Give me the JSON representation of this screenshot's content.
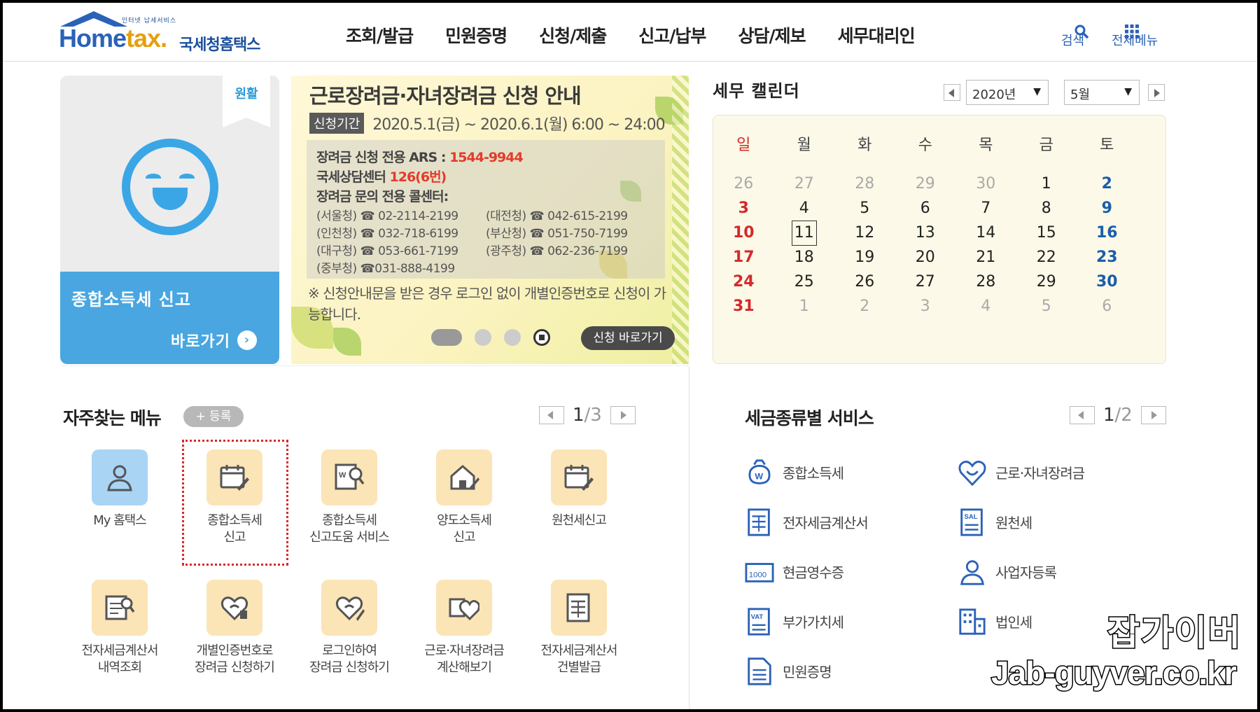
{
  "header": {
    "logo_small": "인터넷 납세서비스",
    "logo_home": "Home",
    "logo_tax": "tax.",
    "logo_name": "국세청홈택스",
    "nav": [
      "조회/발급",
      "민원증명",
      "신청/제출",
      "신고/납부",
      "상담/제보",
      "세무대리인"
    ],
    "search_label": "검색",
    "allmenu_label": "전체메뉴"
  },
  "promo": {
    "ribbon": "원활",
    "title": "종합소득세 신고",
    "go_label": "바로가기"
  },
  "banner": {
    "title": "근로장려금·자녀장려금 신청 안내",
    "period_tag": "신청기간",
    "period_dates": "2020.5.1(금) ~ 2020.6.1(월) 6:00 ~ 24:00",
    "ars_label": "장려금 신청 전용 ARS : ",
    "ars_number": "1544-9944",
    "center_label": "국세상담센터 ",
    "center_number": "126(6번)",
    "callcenter_label": "장려금 문의 전용 콜센터:",
    "tel_rows": [
      [
        "(서울청) ☎ 02-2114-2199",
        "(대전청) ☎ 042-615-2199"
      ],
      [
        "(인천청) ☎ 032-718-6199",
        "(부산청) ☎ 051-750-7199"
      ],
      [
        "(대구청) ☎ 053-661-7199",
        "(광주청) ☎ 062-236-7199"
      ],
      [
        "(중부청) ☎031-888-4199",
        ""
      ]
    ],
    "note": "※ 신청안내문을 받은 경우 로그인 없이 개별인증번호로 신청이 가능합니다.",
    "apply_label": "신청 바로가기"
  },
  "calendar": {
    "title": "세무 캘린더",
    "year": "2020년",
    "month": "5월",
    "weekdays": [
      "일",
      "월",
      "화",
      "수",
      "목",
      "금",
      "토"
    ],
    "weeks": [
      [
        "26",
        "27",
        "28",
        "29",
        "30",
        "1",
        "2"
      ],
      [
        "3",
        "4",
        "5",
        "6",
        "7",
        "8",
        "9"
      ],
      [
        "10",
        "11",
        "12",
        "13",
        "14",
        "15",
        "16"
      ],
      [
        "17",
        "18",
        "19",
        "20",
        "21",
        "22",
        "23"
      ],
      [
        "24",
        "25",
        "26",
        "27",
        "28",
        "29",
        "30"
      ],
      [
        "31",
        "1",
        "2",
        "3",
        "4",
        "5",
        "6"
      ]
    ],
    "today": "11"
  },
  "frequent": {
    "title": "자주찾는 메뉴",
    "register_label": "+ 등록",
    "page": "1",
    "total": "/3",
    "items": [
      {
        "label": "My 홈택스",
        "icon": "person-icon"
      },
      {
        "label": "종합소득세\n신고",
        "icon": "calendar-pen-icon"
      },
      {
        "label": "종합소득세\n신고도움 서비스",
        "icon": "document-search-icon"
      },
      {
        "label": "양도소득세\n신고",
        "icon": "house-pen-icon"
      },
      {
        "label": "원천세신고",
        "icon": "calendar-pen-icon"
      },
      {
        "label": "전자세금계산서\n내역조회",
        "icon": "invoice-search-icon"
      },
      {
        "label": "개별인증번호로\n장려금 신청하기",
        "icon": "heart-key-icon"
      },
      {
        "label": "로그인하여\n장려금 신청하기",
        "icon": "heart-pen-icon"
      },
      {
        "label": "근로·자녀장려금\n계산해보기",
        "icon": "heart-calculator-icon"
      },
      {
        "label": "전자세금계산서\n건별발급",
        "icon": "invoice-icon"
      }
    ]
  },
  "taxservice": {
    "title": "세금종류별 서비스",
    "page": "1",
    "total": "/2",
    "items": [
      {
        "label": "종합소득세",
        "icon": "money-bag-icon"
      },
      {
        "label": "근로·자녀장려금",
        "icon": "heart-icon"
      },
      {
        "label": "전자세금계산서",
        "icon": "invoice-icon"
      },
      {
        "label": "원천세",
        "icon": "salary-icon"
      },
      {
        "label": "현금영수증",
        "icon": "cash-receipt-icon"
      },
      {
        "label": "사업자등록",
        "icon": "person-icon"
      },
      {
        "label": "부가가치세",
        "icon": "vat-icon"
      },
      {
        "label": "법인세",
        "icon": "building-icon"
      },
      {
        "label": "민원증명",
        "icon": "document-icon"
      }
    ],
    "cash_text": "1000",
    "vat_text": "VAT",
    "sal_text": "SAL"
  },
  "watermark": {
    "line1": "잡가이버",
    "line2": "Jab-guyver.co.kr"
  },
  "colors": {
    "brand_blue": "#2a62b8",
    "sky_blue": "#49a6e0",
    "sunday_red": "#d42a2a",
    "saturday_blue": "#1a5eaa",
    "icon_bg": "#fbe4b6"
  }
}
